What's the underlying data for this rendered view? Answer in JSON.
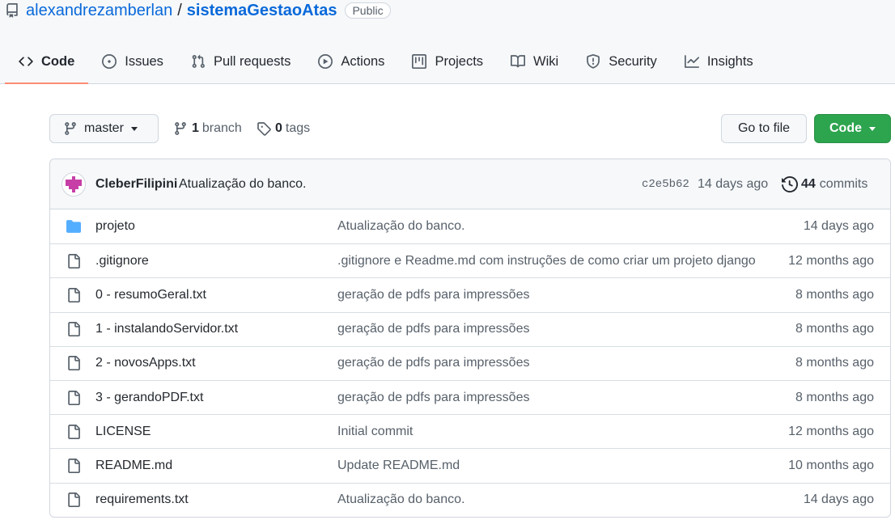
{
  "repo": {
    "owner": "alexandrezamberlan",
    "separator": "/",
    "name": "sistemaGestaoAtas",
    "visibility": "Public"
  },
  "tabs": [
    {
      "label": "Code",
      "icon": "code-icon"
    },
    {
      "label": "Issues",
      "icon": "issue-icon"
    },
    {
      "label": "Pull requests",
      "icon": "pull-request-icon"
    },
    {
      "label": "Actions",
      "icon": "play-icon"
    },
    {
      "label": "Projects",
      "icon": "project-icon"
    },
    {
      "label": "Wiki",
      "icon": "book-icon"
    },
    {
      "label": "Security",
      "icon": "shield-icon"
    },
    {
      "label": "Insights",
      "icon": "graph-icon"
    }
  ],
  "toolbar": {
    "branch": "master",
    "branches_count": "1",
    "branches_label": "branch",
    "tags_count": "0",
    "tags_label": "tags",
    "go_to_file": "Go to file",
    "code_button": "Code"
  },
  "commit": {
    "author": "CleberFilipini",
    "message": "Atualização do banco.",
    "sha": "c2e5b62",
    "age": "14 days ago",
    "count": "44",
    "count_label": "commits"
  },
  "files": [
    {
      "type": "folder",
      "name": "projeto",
      "message": "Atualização do banco.",
      "age": "14 days ago"
    },
    {
      "type": "file",
      "name": ".gitignore",
      "message": ".gitignore e Readme.md com instruções de como criar um projeto django",
      "age": "12 months ago"
    },
    {
      "type": "file",
      "name": "0 - resumoGeral.txt",
      "message": "geração de pdfs para impressões",
      "age": "8 months ago"
    },
    {
      "type": "file",
      "name": "1 - instalandoServidor.txt",
      "message": "geração de pdfs para impressões",
      "age": "8 months ago"
    },
    {
      "type": "file",
      "name": "2 - novosApps.txt",
      "message": "geração de pdfs para impressões",
      "age": "8 months ago"
    },
    {
      "type": "file",
      "name": "3 - gerandoPDF.txt",
      "message": "geração de pdfs para impressões",
      "age": "8 months ago"
    },
    {
      "type": "file",
      "name": "LICENSE",
      "message": "Initial commit",
      "age": "12 months ago"
    },
    {
      "type": "file",
      "name": "README.md",
      "message": "Update README.md",
      "age": "10 months ago"
    },
    {
      "type": "file",
      "name": "requirements.txt",
      "message": "Atualização do banco.",
      "age": "14 days ago"
    }
  ]
}
